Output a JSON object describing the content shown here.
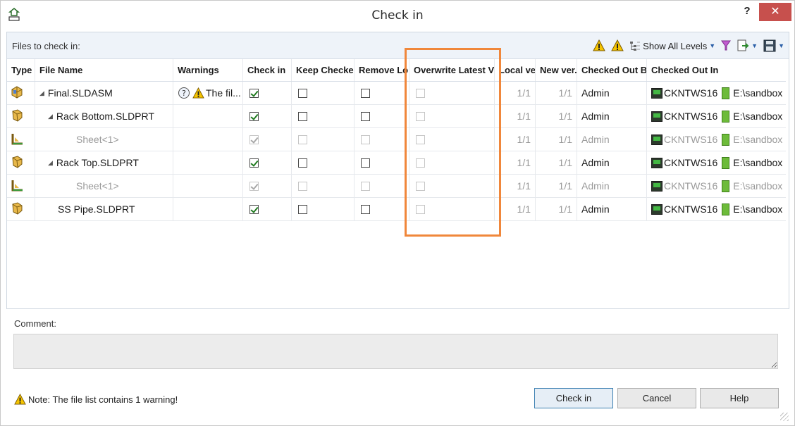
{
  "window": {
    "title": "Check in",
    "help_label": "?",
    "close_label": "✕"
  },
  "files_panel": {
    "label": "Files to check in:",
    "toolbar": {
      "levels_label": "Show All Levels"
    }
  },
  "columns": [
    "Type",
    "File Name",
    "Warnings",
    "Check in",
    "Keep Checke...",
    "Remove Lo...",
    "Overwrite Latest Ve...",
    "Local ver.",
    "New ver.",
    "Checked Out By",
    "Checked Out In"
  ],
  "rows": [
    {
      "type": "assembly-icon",
      "name": "Final.SLDASM",
      "expander": "◢",
      "indent": 0,
      "warning": "The fil...",
      "check_in": true,
      "check_in_enabled": true,
      "keep": false,
      "remove": false,
      "overwrite": false,
      "local": "1/1",
      "new": "1/1",
      "out_by": "Admin",
      "computer": "CKNTWS16",
      "folder": "E:\\sandbox",
      "dim": false
    },
    {
      "type": "part-icon",
      "name": "Rack Bottom.SLDPRT",
      "expander": "◢",
      "indent": 1,
      "warning": "",
      "check_in": true,
      "check_in_enabled": true,
      "keep": false,
      "remove": false,
      "overwrite": false,
      "local": "1/1",
      "new": "1/1",
      "out_by": "Admin",
      "computer": "CKNTWS16",
      "folder": "E:\\sandbox",
      "dim": false
    },
    {
      "type": "drawing-icon",
      "name": "Sheet<1>",
      "expander": "",
      "indent": 2,
      "warning": "",
      "check_in": true,
      "check_in_enabled": false,
      "keep": false,
      "remove": false,
      "overwrite": false,
      "local": "1/1",
      "new": "1/1",
      "out_by": "Admin",
      "computer": "CKNTWS16",
      "folder": "E:\\sandbox",
      "dim": true
    },
    {
      "type": "part-icon",
      "name": "Rack Top.SLDPRT",
      "expander": "◢",
      "indent": 1,
      "warning": "",
      "check_in": true,
      "check_in_enabled": true,
      "keep": false,
      "remove": false,
      "overwrite": false,
      "local": "1/1",
      "new": "1/1",
      "out_by": "Admin",
      "computer": "CKNTWS16",
      "folder": "E:\\sandbox",
      "dim": false
    },
    {
      "type": "drawing-icon",
      "name": "Sheet<1>",
      "expander": "",
      "indent": 2,
      "warning": "",
      "check_in": true,
      "check_in_enabled": false,
      "keep": false,
      "remove": false,
      "overwrite": false,
      "local": "1/1",
      "new": "1/1",
      "out_by": "Admin",
      "computer": "CKNTWS16",
      "folder": "E:\\sandbox",
      "dim": true
    },
    {
      "type": "part-icon",
      "name": "SS Pipe.SLDPRT",
      "expander": "",
      "indent": 1,
      "warning": "",
      "check_in": true,
      "check_in_enabled": true,
      "keep": false,
      "remove": false,
      "overwrite": false,
      "local": "1/1",
      "new": "1/1",
      "out_by": "Admin",
      "computer": "CKNTWS16",
      "folder": "E:\\sandbox",
      "dim": false
    }
  ],
  "comment": {
    "label": "Comment:",
    "value": ""
  },
  "footer": {
    "note": "Note: The file list contains 1 warning!",
    "check_in_button": "Check in",
    "cancel_button": "Cancel",
    "help_button": "Help"
  },
  "colors": {
    "highlight": "#f0873b",
    "close": "#c7504d",
    "panel_header": "#eef3f9"
  }
}
